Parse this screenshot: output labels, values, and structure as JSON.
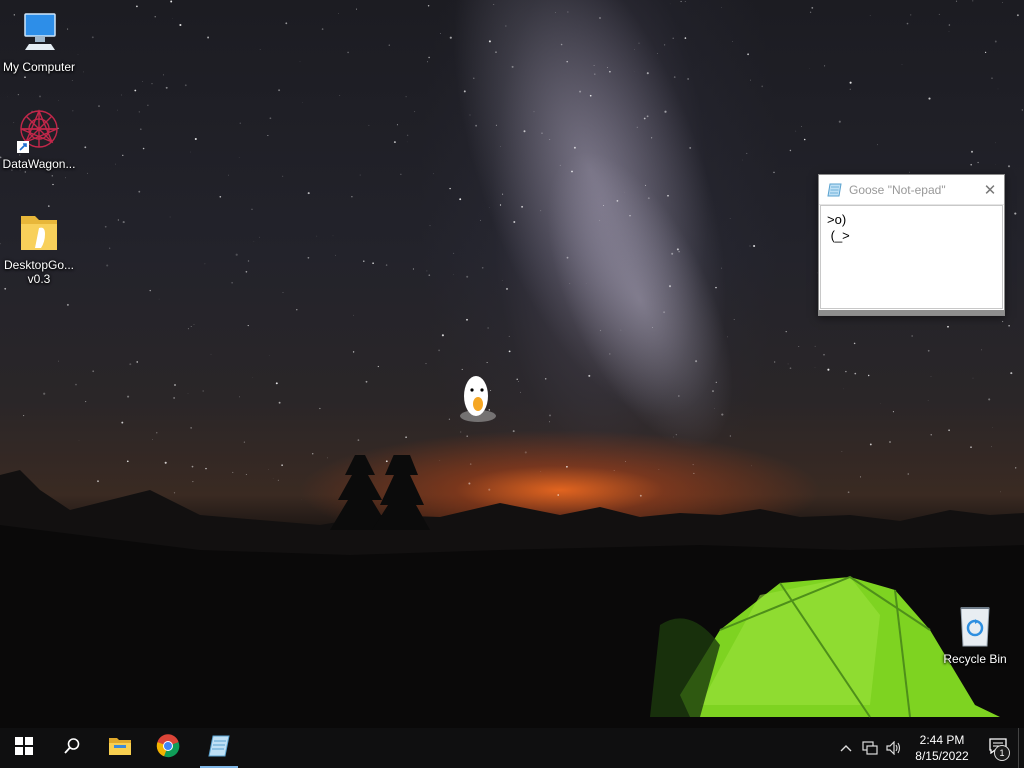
{
  "desktop": {
    "icons": [
      {
        "label": "My Computer",
        "icon": "computer-icon"
      },
      {
        "label": "DataWagon...",
        "icon": "datawagon-icon"
      },
      {
        "label": "DesktopGo... v0.3",
        "icon": "folder-icon"
      },
      {
        "label": "Recycle Bin",
        "icon": "recycle-bin-icon"
      }
    ]
  },
  "goose_window": {
    "title": "Goose \"Not-epad\"",
    "content": ">o)\n (_>",
    "close_icon": "close-icon"
  },
  "taskbar": {
    "start_icon": "windows-start-icon",
    "search_icon": "search-icon",
    "apps": [
      {
        "name": "file-explorer",
        "icon": "folder-icon",
        "active": false
      },
      {
        "name": "chrome",
        "icon": "chrome-icon",
        "active": false
      },
      {
        "name": "notepad",
        "icon": "notepad-icon",
        "active": true
      }
    ],
    "tray": {
      "chevron_icon": "chevron-up-icon",
      "network_icon": "network-icon",
      "volume_icon": "volume-icon",
      "time": "2:44 PM",
      "date": "8/15/2022",
      "notification_count": "1"
    }
  },
  "colors": {
    "tent": "#7ed321",
    "horizon_glow": "#ff6e1e",
    "taskbar": "#0f0f10",
    "active_indicator": "#7fb6e6"
  }
}
